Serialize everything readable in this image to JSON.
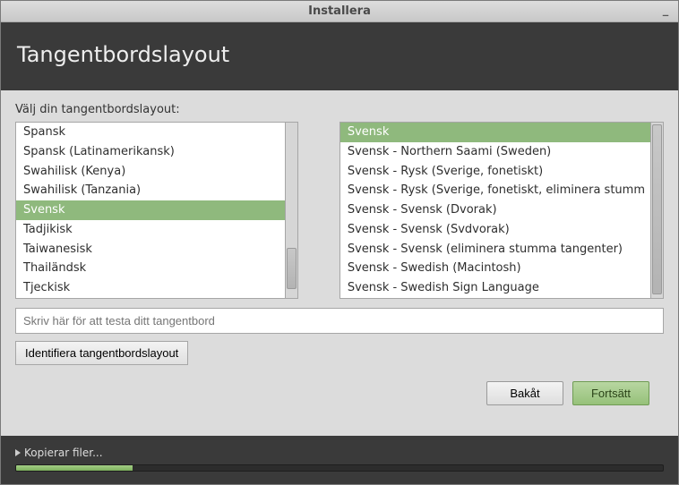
{
  "window": {
    "title": "Installera"
  },
  "header": {
    "title": "Tangentbordslayout"
  },
  "prompt": "Välj din tangentbordslayout:",
  "left_list": {
    "items": [
      {
        "label": "Spansk",
        "selected": false
      },
      {
        "label": "Spansk (Latinamerikansk)",
        "selected": false
      },
      {
        "label": "Swahilisk (Kenya)",
        "selected": false
      },
      {
        "label": "Swahilisk (Tanzania)",
        "selected": false
      },
      {
        "label": "Svensk",
        "selected": true
      },
      {
        "label": "Tadjikisk",
        "selected": false
      },
      {
        "label": "Taiwanesisk",
        "selected": false
      },
      {
        "label": "Thailändsk",
        "selected": false
      },
      {
        "label": "Tjeckisk",
        "selected": false
      }
    ]
  },
  "right_list": {
    "items": [
      {
        "label": "Svensk",
        "selected": true
      },
      {
        "label": "Svensk - Northern Saami (Sweden)",
        "selected": false
      },
      {
        "label": "Svensk - Rysk (Sverige, fonetiskt)",
        "selected": false
      },
      {
        "label": "Svensk - Rysk (Sverige, fonetiskt, eliminera stumm",
        "selected": false
      },
      {
        "label": "Svensk - Svensk (Dvorak)",
        "selected": false
      },
      {
        "label": "Svensk - Svensk (Svdvorak)",
        "selected": false
      },
      {
        "label": "Svensk - Svensk (eliminera stumma tangenter)",
        "selected": false
      },
      {
        "label": "Svensk - Swedish (Macintosh)",
        "selected": false
      },
      {
        "label": "Svensk - Swedish Sign Language",
        "selected": false
      }
    ]
  },
  "test_input": {
    "placeholder": "Skriv här för att testa ditt tangentbord",
    "value": ""
  },
  "detect_button": "Identifiera tangentbordslayout",
  "nav": {
    "back": "Bakåt",
    "forward": "Fortsätt"
  },
  "footer": {
    "status": "Kopierar filer...",
    "progress_pct": 18
  }
}
